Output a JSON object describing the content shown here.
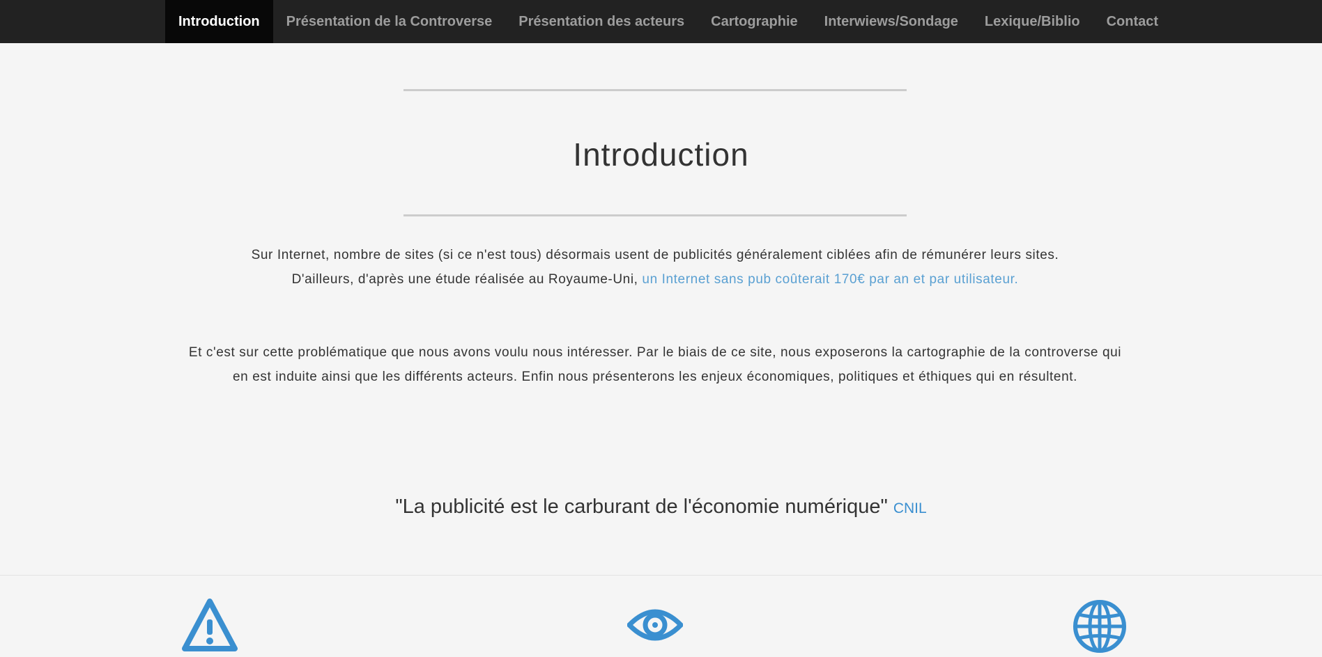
{
  "nav": {
    "items": [
      {
        "label": "Introduction",
        "active": true
      },
      {
        "label": "Présentation de la Controverse",
        "active": false
      },
      {
        "label": "Présentation des acteurs",
        "active": false
      },
      {
        "label": "Cartographie",
        "active": false
      },
      {
        "label": "Interwiews/Sondage",
        "active": false
      },
      {
        "label": "Lexique/Biblio",
        "active": false
      },
      {
        "label": "Contact",
        "active": false
      }
    ]
  },
  "intro": {
    "title": "Introduction",
    "p1_line1": "Sur Internet, nombre de sites (si ce n'est tous) désormais usent de publicités généralement ciblées afin de rémunérer leurs sites.",
    "p1_line2_text": "D'ailleurs, d'après une étude réalisée au Royaume-Uni, ",
    "p1_line2_link": "un Internet sans pub coûterait 170€ par an et par utilisateur.",
    "p2": "Et c'est sur cette problématique que nous avons voulu nous intéresser. Par le biais de ce site, nous exposerons la cartographie de la controverse qui en est induite ainsi que les différents acteurs. Enfin nous présenterons les enjeux économiques, politiques et éthiques qui en résultent.",
    "quote": "\"La publicité est le carburant de l'économie numérique\"",
    "quote_source": "CNIL"
  },
  "features": {
    "icons": [
      "warning-icon",
      "eye-icon",
      "globe-icon"
    ],
    "icon_color": "#3a8fd0"
  },
  "colors": {
    "navbar_bg": "#222222",
    "nav_active_bg": "#080808",
    "nav_text": "#9d9d9d",
    "link": "#5aa0d2",
    "page_bg": "#f5f5f5"
  }
}
